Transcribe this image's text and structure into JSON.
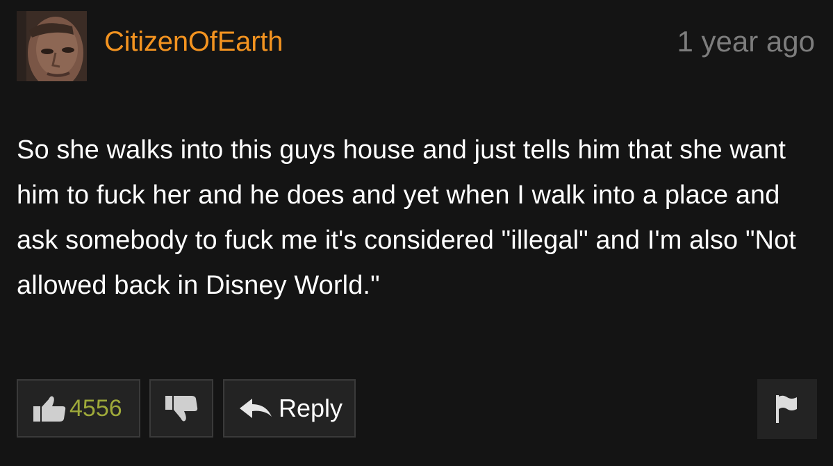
{
  "comment": {
    "username": "CitizenOfEarth",
    "timestamp": "1 year ago",
    "text": "So she walks into this guys house and just tells him that she want him to fuck her and he does and yet when I walk into a place and ask somebody to fuck me it's considered \"illegal\" and I'm also \"Not allowed back in Disney World.\"",
    "like_count": "4556",
    "reply_label": "Reply",
    "icons": {
      "like": "thumbs-up-icon",
      "dislike": "thumbs-down-icon",
      "reply": "reply-arrow-icon",
      "flag": "flag-icon"
    },
    "colors": {
      "username": "#f39320",
      "timestamp": "#7d7d7d",
      "like_count": "#9ea93a",
      "background": "#141414",
      "button_bg": "#232323"
    }
  }
}
